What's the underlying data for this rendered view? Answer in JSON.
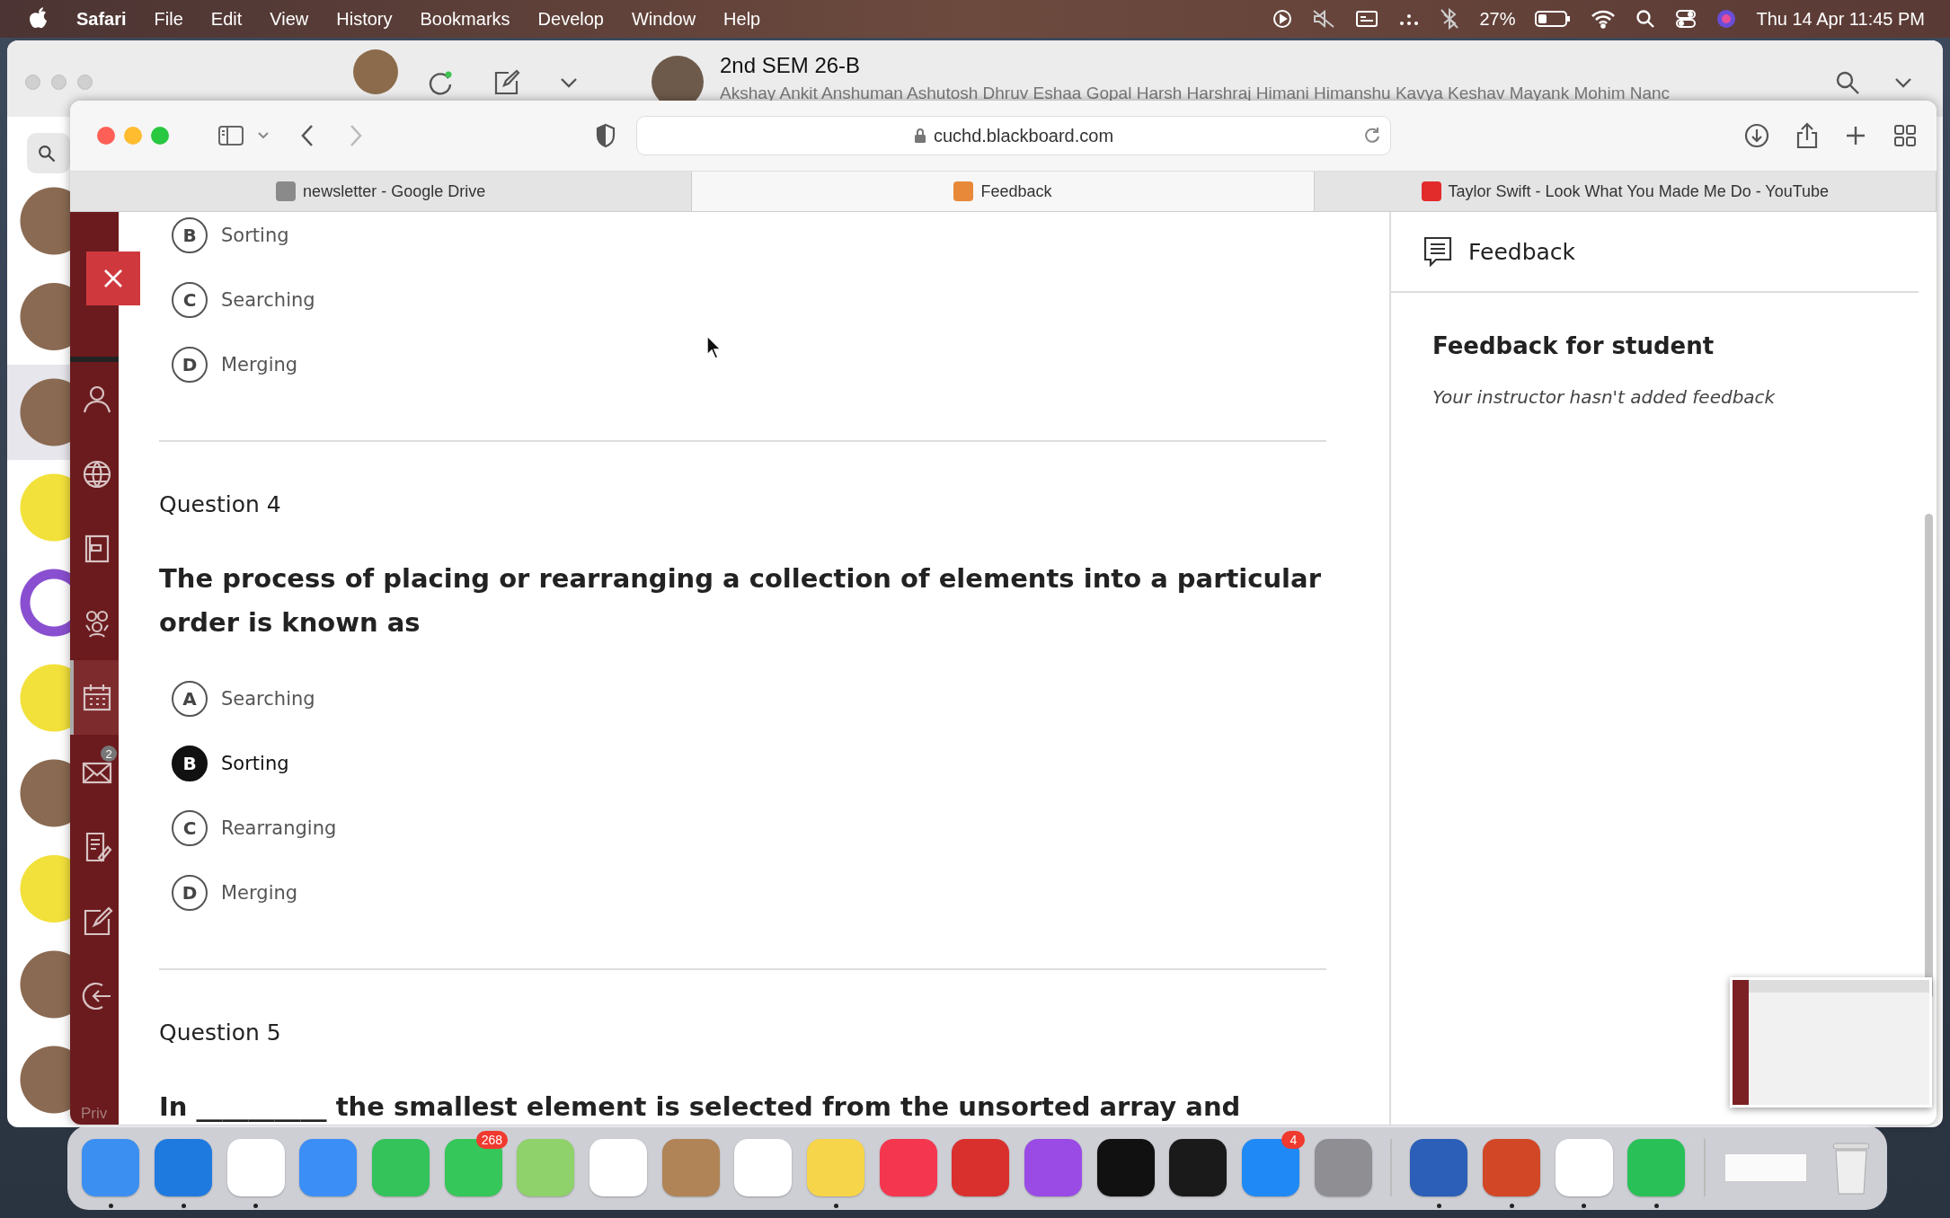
{
  "menu_bar": {
    "app": "Safari",
    "items": [
      "File",
      "Edit",
      "View",
      "History",
      "Bookmarks",
      "Develop",
      "Window",
      "Help"
    ],
    "battery": "27%",
    "datetime": "Thu 14 Apr  11:45 PM"
  },
  "chat_window": {
    "title": "2nd SEM 26-B",
    "members": "Akshay  Ankit  Anshuman  Ashutosh  Dhruv  Eshaa  Gopal  Harsh  Harshraj  Himani  Himanshu  Kavya    Keshav  Mayank  Mohim  Nanc",
    "chats": [
      {
        "kind": "photo",
        "selected": false
      },
      {
        "kind": "photo",
        "selected": false
      },
      {
        "kind": "photo",
        "selected": true
      },
      {
        "kind": "logo",
        "selected": false
      },
      {
        "kind": "gear",
        "selected": false
      },
      {
        "kind": "logo",
        "selected": false
      },
      {
        "kind": "photo",
        "selected": false
      },
      {
        "kind": "logo",
        "selected": false
      },
      {
        "kind": "photo",
        "selected": false
      },
      {
        "kind": "photo",
        "selected": false
      }
    ]
  },
  "browser": {
    "url": "cuchd.blackboard.com",
    "tabs": [
      {
        "title": "newsletter - Google Drive",
        "kind": "drive",
        "selected": false
      },
      {
        "title": "Feedback",
        "kind": "pencil",
        "selected": true
      },
      {
        "title": "Taylor Swift - Look What You Made Me Do - YouTube",
        "kind": "youtube",
        "selected": false
      }
    ]
  },
  "sidebar": {
    "items": [
      {
        "kind": "user",
        "selected": false
      },
      {
        "kind": "globe",
        "selected": false
      },
      {
        "kind": "book",
        "selected": false
      },
      {
        "kind": "people",
        "selected": false
      },
      {
        "kind": "calendar",
        "selected": true
      },
      {
        "kind": "mail",
        "selected": false,
        "badge": "2"
      },
      {
        "kind": "notes",
        "selected": false
      },
      {
        "kind": "edit",
        "selected": false
      },
      {
        "kind": "logout",
        "selected": false
      }
    ],
    "footer": "Priv"
  },
  "questions": [
    {
      "options": [
        {
          "letter": "B",
          "text": "Sorting",
          "selected": false
        },
        {
          "letter": "C",
          "text": "Searching",
          "selected": false
        },
        {
          "letter": "D",
          "text": "Merging",
          "selected": false
        }
      ]
    },
    {
      "label": "Question 4",
      "text": "The process of placing or rearranging a collection of elements into a particular order is known as",
      "options": [
        {
          "letter": "A",
          "text": "Searching",
          "selected": false
        },
        {
          "letter": "B",
          "text": "Sorting",
          "selected": true
        },
        {
          "letter": "C",
          "text": "Rearranging",
          "selected": false
        },
        {
          "letter": "D",
          "text": "Merging",
          "selected": false
        }
      ]
    },
    {
      "label": "Question 5",
      "text": "In __________ the smallest element is selected from the unsorted array and"
    }
  ],
  "feedback": {
    "title": "Feedback",
    "heading": "Feedback for student",
    "note": "Your instructor hasn't added feedback"
  },
  "dock": {
    "apps": [
      {
        "kind": "finder",
        "running": true
      },
      {
        "kind": "safari",
        "running": true
      },
      {
        "kind": "chrome",
        "running": true
      },
      {
        "kind": "mail",
        "running": false
      },
      {
        "kind": "facetime",
        "running": false
      },
      {
        "kind": "messages",
        "running": false,
        "badge": "268"
      },
      {
        "kind": "maps",
        "running": false
      },
      {
        "kind": "photos",
        "running": false
      },
      {
        "kind": "contacts",
        "running": false
      },
      {
        "kind": "reminders",
        "running": false
      },
      {
        "kind": "notes",
        "running": true
      },
      {
        "kind": "music",
        "running": false
      },
      {
        "kind": "photobooth",
        "running": false
      },
      {
        "kind": "podcasts",
        "running": false
      },
      {
        "kind": "tv",
        "running": false
      },
      {
        "kind": "terminal",
        "running": false
      },
      {
        "kind": "appstore",
        "running": false,
        "badge": "4"
      },
      {
        "kind": "settings",
        "running": false
      },
      {
        "kind": "word",
        "running": true
      },
      {
        "kind": "powerpoint",
        "running": true
      },
      {
        "kind": "vscode",
        "running": true
      },
      {
        "kind": "whatsapp",
        "running": true
      }
    ],
    "extras": [
      {
        "kind": "minimized"
      },
      {
        "kind": "trash"
      }
    ]
  }
}
